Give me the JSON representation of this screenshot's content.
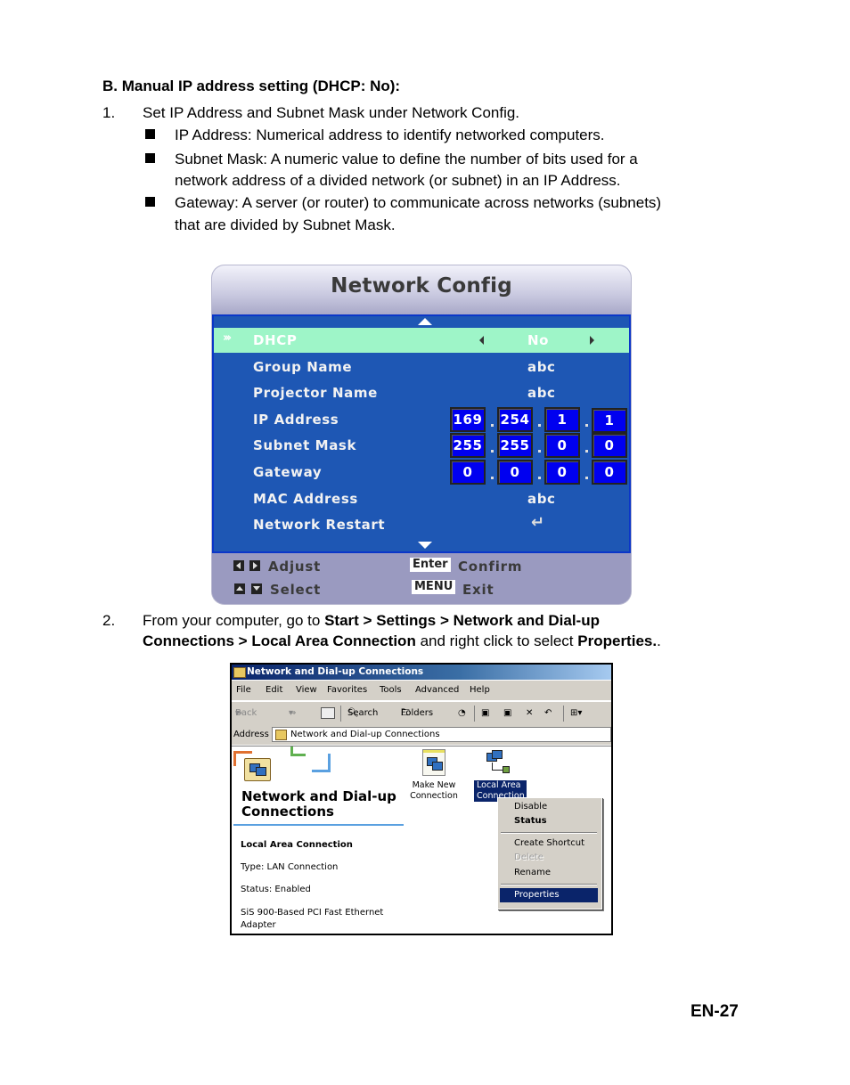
{
  "heading": "B. Manual IP address setting (DHCP: No):",
  "step1": {
    "number": "1.",
    "text": "Set IP Address and Subnet Mask under Network Config.",
    "bullets": [
      {
        "line1": "IP Address: Numerical address to identify networked computers.",
        "line2": ""
      },
      {
        "line1": "Subnet Mask: A numeric value to define the number of bits used for a",
        "line2": "network address of a divided network (or subnet) in an IP Address."
      },
      {
        "line1": "Gateway: A server (or router) to communicate across networks (subnets)",
        "line2": "that are divided by Subnet Mask."
      }
    ]
  },
  "osd": {
    "title": "Network Config",
    "rows": [
      {
        "label": "DHCP",
        "value": "No",
        "selected": true
      },
      {
        "label": "Group Name",
        "value": "abc"
      },
      {
        "label": "Projector Name",
        "value": "abc"
      },
      {
        "label": "IP Address",
        "octets": [
          "169",
          "254",
          "1",
          "1"
        ]
      },
      {
        "label": "Subnet Mask",
        "octets": [
          "255",
          "255",
          "0",
          "0"
        ]
      },
      {
        "label": "Gateway",
        "octets": [
          "0",
          "0",
          "0",
          "0"
        ]
      },
      {
        "label": "MAC Address",
        "value": "abc"
      },
      {
        "label": "Network Restart",
        "value": "↵"
      }
    ],
    "footer": {
      "adjust": "Adjust",
      "select": "Select",
      "enter_key": "Enter",
      "confirm": "Confirm",
      "menu_key": "MENU",
      "exit": "Exit"
    }
  },
  "step2": {
    "number": "2.",
    "part1": "From your computer, go to ",
    "bold1": "Start > Settings > Network and Dial-up",
    "bold2": "Connections > Local Area Connection",
    "part2": " and right click to select ",
    "bold3": "Properties.",
    "part3": "."
  },
  "window": {
    "title": "Network and Dial-up Connections",
    "menu": [
      "File",
      "Edit",
      "View",
      "Favorites",
      "Tools",
      "Advanced",
      "Help"
    ],
    "toolbar": {
      "back": "Back",
      "search": "Search",
      "folders": "Folders"
    },
    "address_label": "Address",
    "address_value": "Network and Dial-up Connections",
    "panel_title_1": "Network and Dial-up",
    "panel_title_2": "Connections",
    "details": {
      "name": "Local Area Connection",
      "type": "Type: LAN Connection",
      "status": "Status: Enabled",
      "adapter_1": "SiS 900-Based PCI Fast Ethernet",
      "adapter_2": "Adapter"
    },
    "icons": [
      {
        "label1": "Make New",
        "label2": "Connection"
      },
      {
        "label1": "Local Area",
        "label2": "Connection"
      }
    ],
    "context_menu": [
      {
        "label": "Disable"
      },
      {
        "label": "Status",
        "bold": true
      },
      {
        "label": "Create Shortcut"
      },
      {
        "label": "Delete",
        "disabled": true
      },
      {
        "label": "Rename"
      },
      {
        "label": "Properties",
        "highlighted": true
      }
    ]
  },
  "page_number": "EN-27"
}
